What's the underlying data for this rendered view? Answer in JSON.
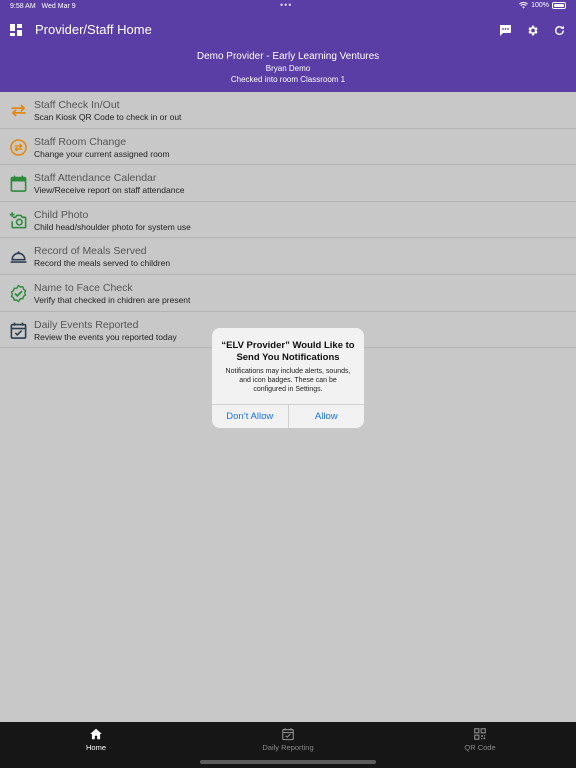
{
  "status": {
    "time": "9:58 AM",
    "date": "Wed Mar 9",
    "battery": "100%"
  },
  "nav": {
    "title": "Provider/Staff Home"
  },
  "header": {
    "org": "Demo Provider - Early Learning Ventures",
    "user": "Bryan Demo",
    "room": "Checked into room Classroom 1"
  },
  "colors": {
    "brand": "#5b3ea5",
    "orange": "#e6880e",
    "green": "#2e8b3d",
    "navy": "#2c3e50",
    "link": "#1a73e8"
  },
  "menu": [
    {
      "title": "Staff Check In/Out",
      "subtitle": "Scan Kiosk QR Code to check in or out",
      "icon": "swap-arrows-icon"
    },
    {
      "title": "Staff Room Change",
      "subtitle": "Change your current assigned room",
      "icon": "circle-swap-icon"
    },
    {
      "title": "Staff Attendance Calendar",
      "subtitle": "View/Receive report on staff attendance",
      "icon": "calendar-icon"
    },
    {
      "title": "Child Photo",
      "subtitle": "Child head/shoulder photo for system use",
      "icon": "add-camera-icon"
    },
    {
      "title": "Record of Meals Served",
      "subtitle": "Record the meals served to children",
      "icon": "meal-cloche-icon"
    },
    {
      "title": "Name to Face Check",
      "subtitle": "Verify that checked in chidren are present",
      "icon": "verified-check-icon"
    },
    {
      "title": "Daily Events Reported",
      "subtitle": "Review the events you reported today",
      "icon": "calendar-check-icon"
    }
  ],
  "alert": {
    "title": "“ELV Provider” Would Like to Send You Notifications",
    "message": "Notifications may include alerts, sounds, and icon badges. These can be configured in Settings.",
    "deny": "Don’t Allow",
    "allow": "Allow"
  },
  "tabs": [
    {
      "label": "Home",
      "icon": "home-icon",
      "active": true
    },
    {
      "label": "Daily Reporting",
      "icon": "calendar-check-icon",
      "active": false
    },
    {
      "label": "QR Code",
      "icon": "qr-code-icon",
      "active": false
    }
  ]
}
